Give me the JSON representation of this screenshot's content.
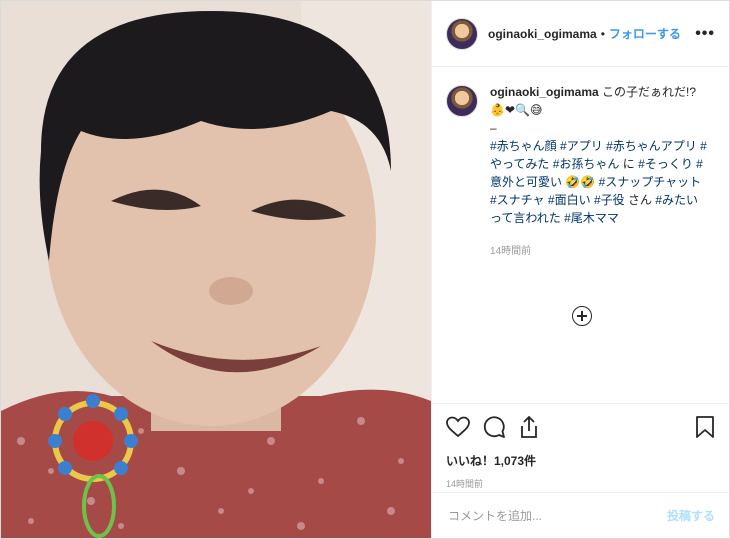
{
  "photo": {
    "alt": ""
  },
  "header": {
    "username": "oginaoki_ogimama",
    "separator": "•",
    "follow_label": "フォローする",
    "more_label": "•••"
  },
  "caption": {
    "username": "oginaoki_ogimama",
    "line1": "この子だぁれだ!?",
    "emoji": "👶❤🔍😅",
    "dash": "–",
    "tags": [
      "#赤ちゃん顔",
      "#アプリ",
      "#赤ちゃんアプリ",
      "#やってみた",
      "#お孫ちゃん",
      "に",
      "#そっくり",
      "#意外と可愛い",
      "🤣🤣",
      "#スナップチャット",
      "#スナチャ",
      "#面白い",
      "#子役",
      "さん",
      "#みたいって言われた",
      "#尾木ママ"
    ],
    "time": "14時間前"
  },
  "actions": {
    "likes_label": "いいね！1,073件",
    "time": "14時間前"
  },
  "comment": {
    "placeholder": "コメントを追加...",
    "post_label": "投稿する"
  },
  "icons": [
    "heart-icon",
    "comment-icon",
    "share-icon",
    "bookmark-icon",
    "plus-circle-icon",
    "more-icon"
  ]
}
